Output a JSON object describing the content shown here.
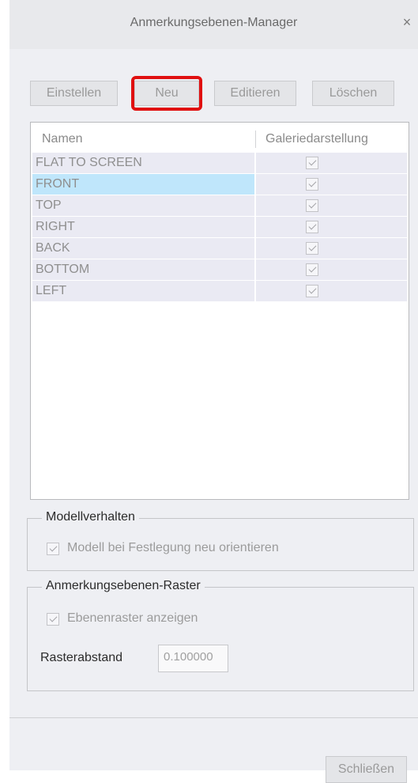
{
  "window": {
    "title": "Anmerkungsebenen-Manager",
    "close_glyph": "×"
  },
  "toolbar": {
    "set_label": "Einstellen",
    "new_label": "Neu",
    "edit_label": "Editieren",
    "delete_label": "Löschen"
  },
  "list": {
    "columns": [
      "Namen",
      "Galeriedarstellung"
    ],
    "rows": [
      {
        "name": "FLAT TO SCREEN",
        "checked": true
      },
      {
        "name": "FRONT",
        "checked": true,
        "selected": true
      },
      {
        "name": "TOP",
        "checked": true
      },
      {
        "name": "RIGHT",
        "checked": true
      },
      {
        "name": "BACK",
        "checked": true
      },
      {
        "name": "BOTTOM",
        "checked": true
      },
      {
        "name": "LEFT",
        "checked": true
      }
    ]
  },
  "model_behavior": {
    "legend": "Modellverhalten",
    "reorient_label": "Modell bei Festlegung neu orientieren",
    "reorient_checked": true
  },
  "grid": {
    "legend": "Anmerkungsebenen-Raster",
    "show_grid_label": "Ebenenraster anzeigen",
    "show_grid_checked": true,
    "spacing_label": "Rasterabstand",
    "spacing_value": "0.100000"
  },
  "footer": {
    "close_label": "Schließen"
  },
  "colors": {
    "highlight": "#e01010",
    "selection": "#bfe6fb",
    "row_bg": "#eaeaf3"
  }
}
